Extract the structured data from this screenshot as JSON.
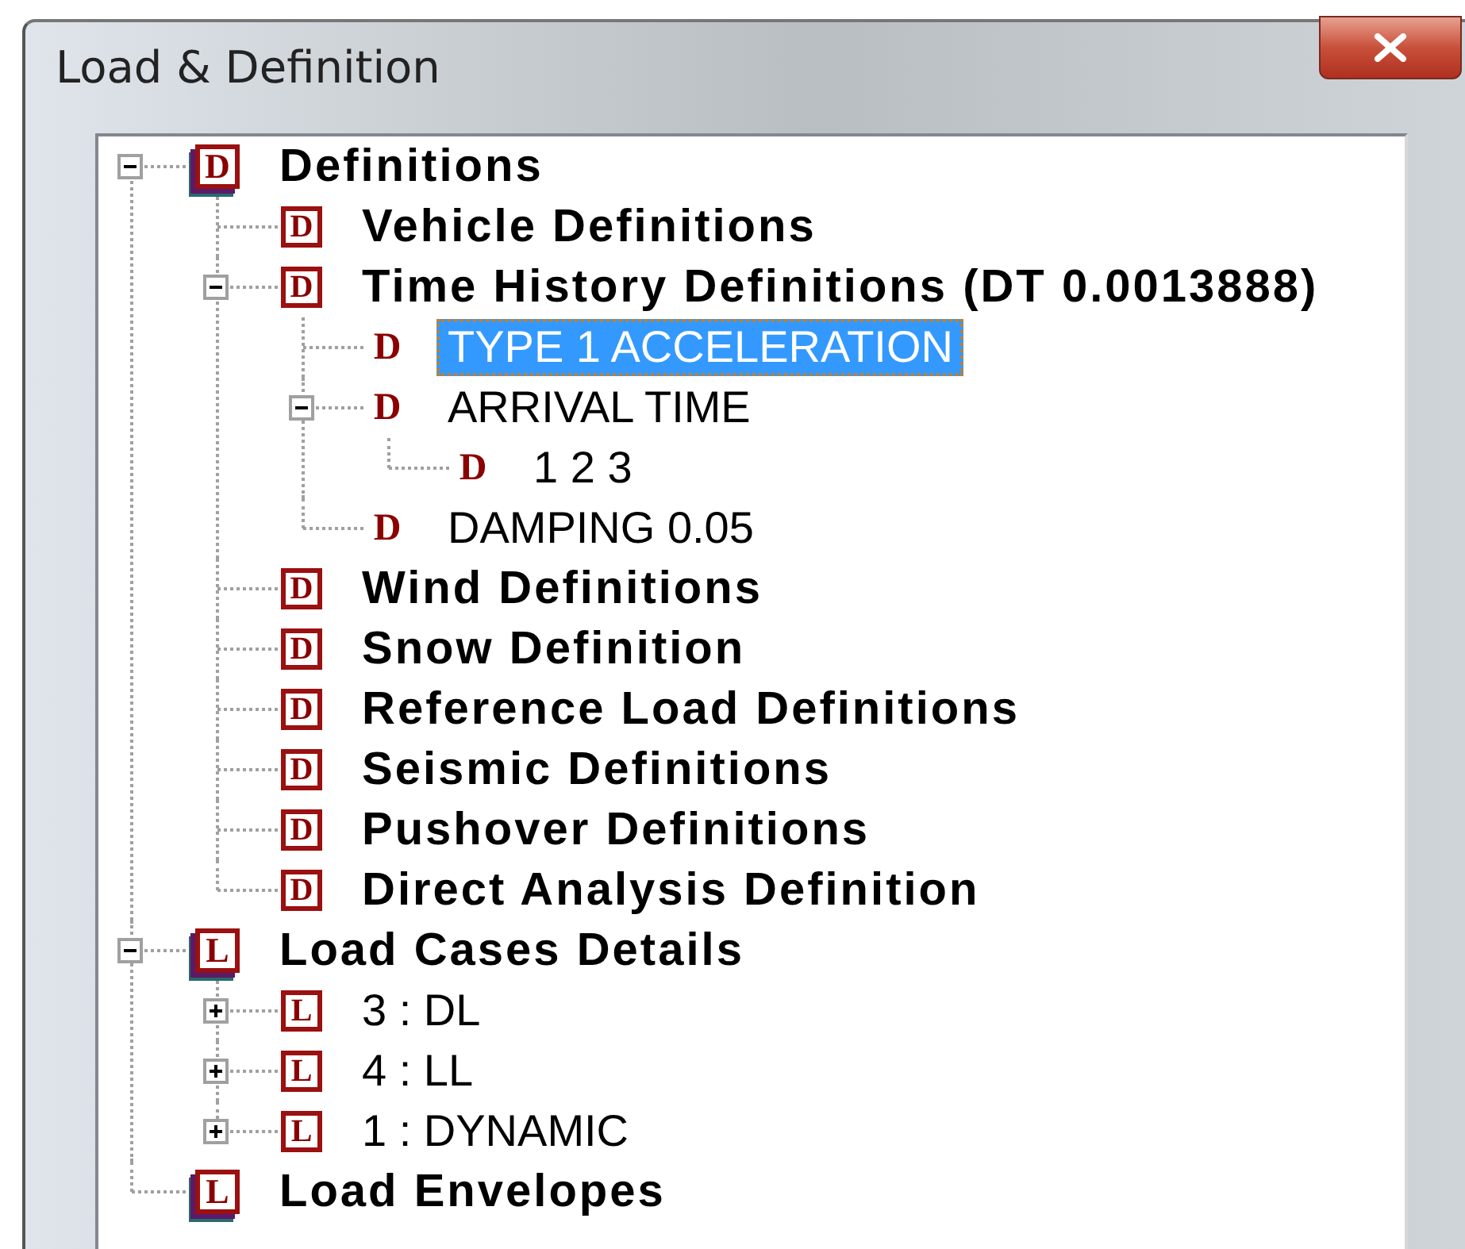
{
  "window": {
    "title": "Load & Definition"
  },
  "tree": [
    {
      "label": "Definitions",
      "icon": {
        "kind": "stacked",
        "letter": "D"
      },
      "bold": true,
      "selected": false,
      "expanded": true,
      "children": [
        {
          "label": "Vehicle Definitions",
          "icon": {
            "kind": "boxed",
            "letter": "D"
          },
          "bold": true,
          "selected": false
        },
        {
          "label": "Time History Definitions (DT 0.0013888)",
          "icon": {
            "kind": "boxed",
            "letter": "D"
          },
          "bold": true,
          "selected": false,
          "expanded": true,
          "children": [
            {
              "label": "TYPE 1 ACCELERATION",
              "icon": {
                "kind": "plain",
                "letter": "D"
              },
              "bold": false,
              "selected": true
            },
            {
              "label": "ARRIVAL TIME",
              "icon": {
                "kind": "plain",
                "letter": "D"
              },
              "bold": false,
              "selected": false,
              "expanded": true,
              "children": [
                {
                  "label": "1 2 3",
                  "icon": {
                    "kind": "plain",
                    "letter": "D"
                  },
                  "bold": false,
                  "selected": false
                }
              ]
            },
            {
              "label": "DAMPING 0.05",
              "icon": {
                "kind": "plain",
                "letter": "D"
              },
              "bold": false,
              "selected": false
            }
          ]
        },
        {
          "label": "Wind Definitions",
          "icon": {
            "kind": "boxed",
            "letter": "D"
          },
          "bold": true,
          "selected": false
        },
        {
          "label": "Snow Definition",
          "icon": {
            "kind": "boxed",
            "letter": "D"
          },
          "bold": true,
          "selected": false
        },
        {
          "label": "Reference Load Definitions",
          "icon": {
            "kind": "boxed",
            "letter": "D"
          },
          "bold": true,
          "selected": false
        },
        {
          "label": "Seismic Definitions",
          "icon": {
            "kind": "boxed",
            "letter": "D"
          },
          "bold": true,
          "selected": false
        },
        {
          "label": "Pushover Definitions",
          "icon": {
            "kind": "boxed",
            "letter": "D"
          },
          "bold": true,
          "selected": false
        },
        {
          "label": "Direct Analysis Definition",
          "icon": {
            "kind": "boxed",
            "letter": "D"
          },
          "bold": true,
          "selected": false
        }
      ]
    },
    {
      "label": "Load Cases Details",
      "icon": {
        "kind": "stacked",
        "letter": "L"
      },
      "bold": true,
      "selected": false,
      "expanded": true,
      "children": [
        {
          "label": "3 : DL",
          "icon": {
            "kind": "boxed",
            "letter": "L"
          },
          "bold": false,
          "selected": false,
          "expanded": false
        },
        {
          "label": "4 : LL",
          "icon": {
            "kind": "boxed",
            "letter": "L"
          },
          "bold": false,
          "selected": false,
          "expanded": false
        },
        {
          "label": "1 : DYNAMIC",
          "icon": {
            "kind": "boxed",
            "letter": "L"
          },
          "bold": false,
          "selected": false,
          "expanded": false
        }
      ]
    },
    {
      "label": "Load Envelopes",
      "icon": {
        "kind": "stacked",
        "letter": "L"
      },
      "bold": true,
      "selected": false
    }
  ]
}
